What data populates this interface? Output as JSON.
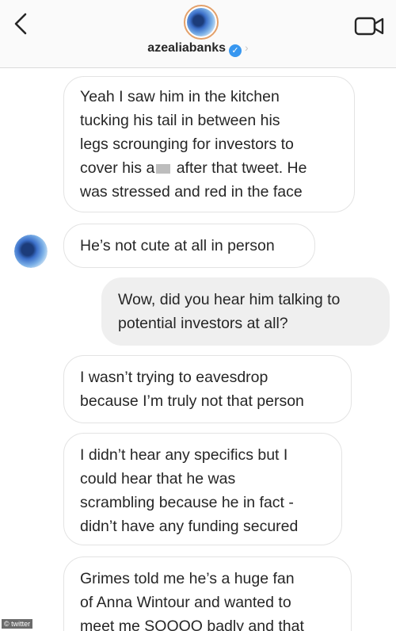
{
  "header": {
    "username": "azealiabanks",
    "verified_mark": "✓",
    "chevron": "›",
    "icons": {
      "back": "chevron-left-icon",
      "video": "video-camera-icon",
      "verified": "verified-badge-icon"
    }
  },
  "messages": [
    {
      "direction": "received",
      "lines": [
        "Yeah I saw him in the kitchen",
        "tucking his tail in between his",
        "legs scrounging for investors to",
        "cover his a",
        "was stressed and red in the face"
      ],
      "line4_after": " after that tweet. He"
    },
    {
      "direction": "received",
      "lines": [
        "He’s not cute at all in person"
      ]
    },
    {
      "direction": "sent",
      "lines": [
        "Wow, did you hear him talking to",
        "potential investors at all?"
      ]
    },
    {
      "direction": "received",
      "lines": [
        "I wasn’t trying to eavesdrop",
        "because I’m truly not that person"
      ]
    },
    {
      "direction": "received",
      "lines": [
        "I didn’t hear any specifics but I",
        "could hear that he was",
        "scrambling because he in fact -",
        "didn’t have any funding secured"
      ]
    },
    {
      "direction": "received",
      "lines": [
        "Grimes told me he’s a huge fan",
        "of Anna Wintour and wanted to",
        "meet me SOOOO badly and that"
      ]
    }
  ],
  "watermark": "© twitter",
  "colors": {
    "sent_bubble": "#efefef",
    "received_border": "#e3e3e3",
    "verified": "#3897f0"
  }
}
